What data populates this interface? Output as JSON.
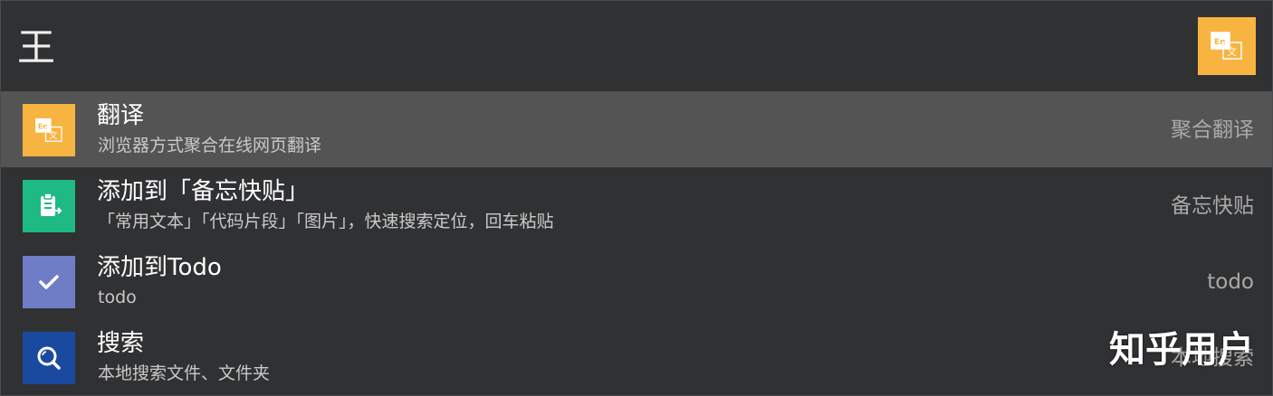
{
  "search": {
    "query": "王"
  },
  "header": {
    "plugin_icon": "translate-icon",
    "plugin_color": "#f8b440"
  },
  "results": [
    {
      "title": "翻译",
      "subtitle": "浏览器方式聚合在线网页翻译",
      "tag": "聚合翻译",
      "icon": "translate-icon",
      "icon_color": "#f8b440",
      "selected": true
    },
    {
      "title": "添加到「备忘快贴」",
      "subtitle": "「常用文本」「代码片段」「图片」，快速搜索定位，回车粘贴",
      "tag": "备忘快贴",
      "icon": "clipboard-icon",
      "icon_color": "#1fb983",
      "selected": false
    },
    {
      "title": "添加到Todo",
      "subtitle": "todo",
      "tag": "todo",
      "icon": "checkmark-icon",
      "icon_color": "#6f7dc6",
      "selected": false
    },
    {
      "title": "搜索",
      "subtitle": "本地搜索文件、文件夹",
      "tag": "本地搜索",
      "icon": "search-icon",
      "icon_color": "#1a4aa0",
      "selected": false
    }
  ],
  "watermark": {
    "text": "知乎用户"
  }
}
